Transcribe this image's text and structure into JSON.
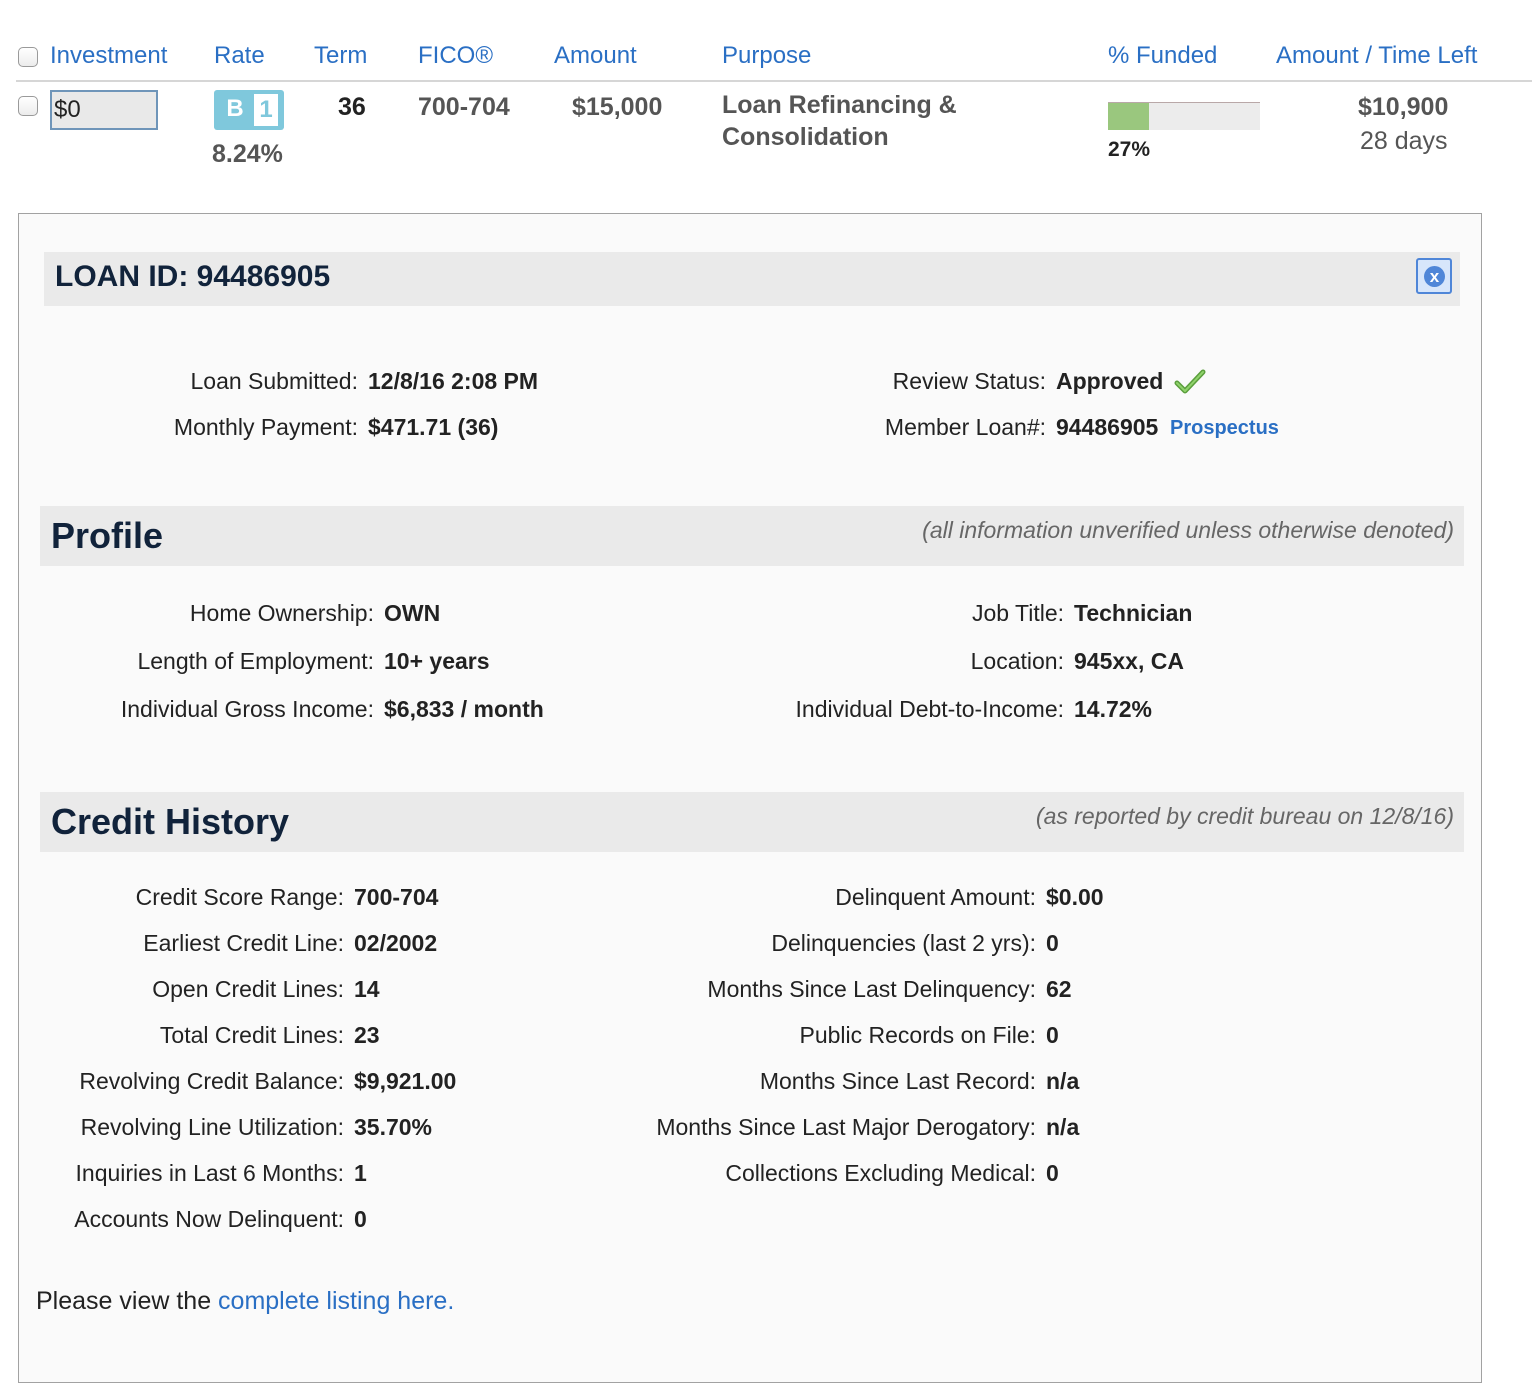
{
  "header": {
    "investment": "Investment",
    "rate": "Rate",
    "term": "Term",
    "fico": "FICO®",
    "amount": "Amount",
    "purpose": "Purpose",
    "funded": "% Funded",
    "amount_time_left": "Amount / Time Left"
  },
  "loan_row": {
    "investment_value": "$0",
    "grade_letter": "B",
    "grade_number": "1",
    "rate": "8.24%",
    "term": "36",
    "fico": "700-704",
    "amount": "$15,000",
    "purpose_line1": "Loan Refinancing &",
    "purpose_line2": "Consolidation",
    "funded_percent": 27,
    "funded_label": "27%",
    "amount_left": "$10,900",
    "time_left": "28 days"
  },
  "detail": {
    "loan_id_title": "LOAN ID: 94486905",
    "close_icon": "x",
    "summary": {
      "loan_submitted_label": "Loan Submitted:",
      "loan_submitted_value": "12/8/16 2:08 PM",
      "monthly_payment_label": "Monthly Payment:",
      "monthly_payment_value": "$471.71 (36)",
      "review_status_label": "Review Status:",
      "review_status_value": "Approved",
      "member_loan_label": "Member Loan#:",
      "member_loan_value": "94486905",
      "prospectus_link": "Prospectus"
    },
    "profile": {
      "title": "Profile",
      "note": "(all information unverified unless otherwise denoted)",
      "left": [
        {
          "label": "Home Ownership:",
          "value": "OWN"
        },
        {
          "label": "Length of Employment:",
          "value": "10+ years"
        },
        {
          "label": "Individual Gross Income:",
          "value": "$6,833 / month"
        }
      ],
      "right": [
        {
          "label": "Job Title:",
          "value": "Technician"
        },
        {
          "label": "Location:",
          "value": "945xx, CA"
        },
        {
          "label": "Individual Debt-to-Income:",
          "value": "14.72%"
        }
      ]
    },
    "credit": {
      "title": "Credit History",
      "note": "(as reported by credit bureau on 12/8/16)",
      "left": [
        {
          "label": "Credit Score Range:",
          "value": "700-704"
        },
        {
          "label": "Earliest Credit Line:",
          "value": "02/2002"
        },
        {
          "label": "Open Credit Lines:",
          "value": "14"
        },
        {
          "label": "Total Credit Lines:",
          "value": "23"
        },
        {
          "label": "Revolving Credit Balance:",
          "value": "$9,921.00"
        },
        {
          "label": "Revolving Line Utilization:",
          "value": "35.70%"
        },
        {
          "label": "Inquiries in Last 6 Months:",
          "value": "1"
        },
        {
          "label": "Accounts Now Delinquent:",
          "value": "0"
        }
      ],
      "right": [
        {
          "label": "Delinquent Amount:",
          "value": "$0.00"
        },
        {
          "label": "Delinquencies (last 2 yrs):",
          "value": "0"
        },
        {
          "label": "Months Since Last Delinquency:",
          "value": "62"
        },
        {
          "label": "Public Records on File:",
          "value": "0"
        },
        {
          "label": "Months Since Last Record:",
          "value": "n/a"
        },
        {
          "label": "Months Since Last Major Derogatory:",
          "value": "n/a"
        },
        {
          "label": "Collections Excluding Medical:",
          "value": "0"
        }
      ]
    },
    "footer_text": "Please view the ",
    "footer_link": "complete listing here."
  }
}
